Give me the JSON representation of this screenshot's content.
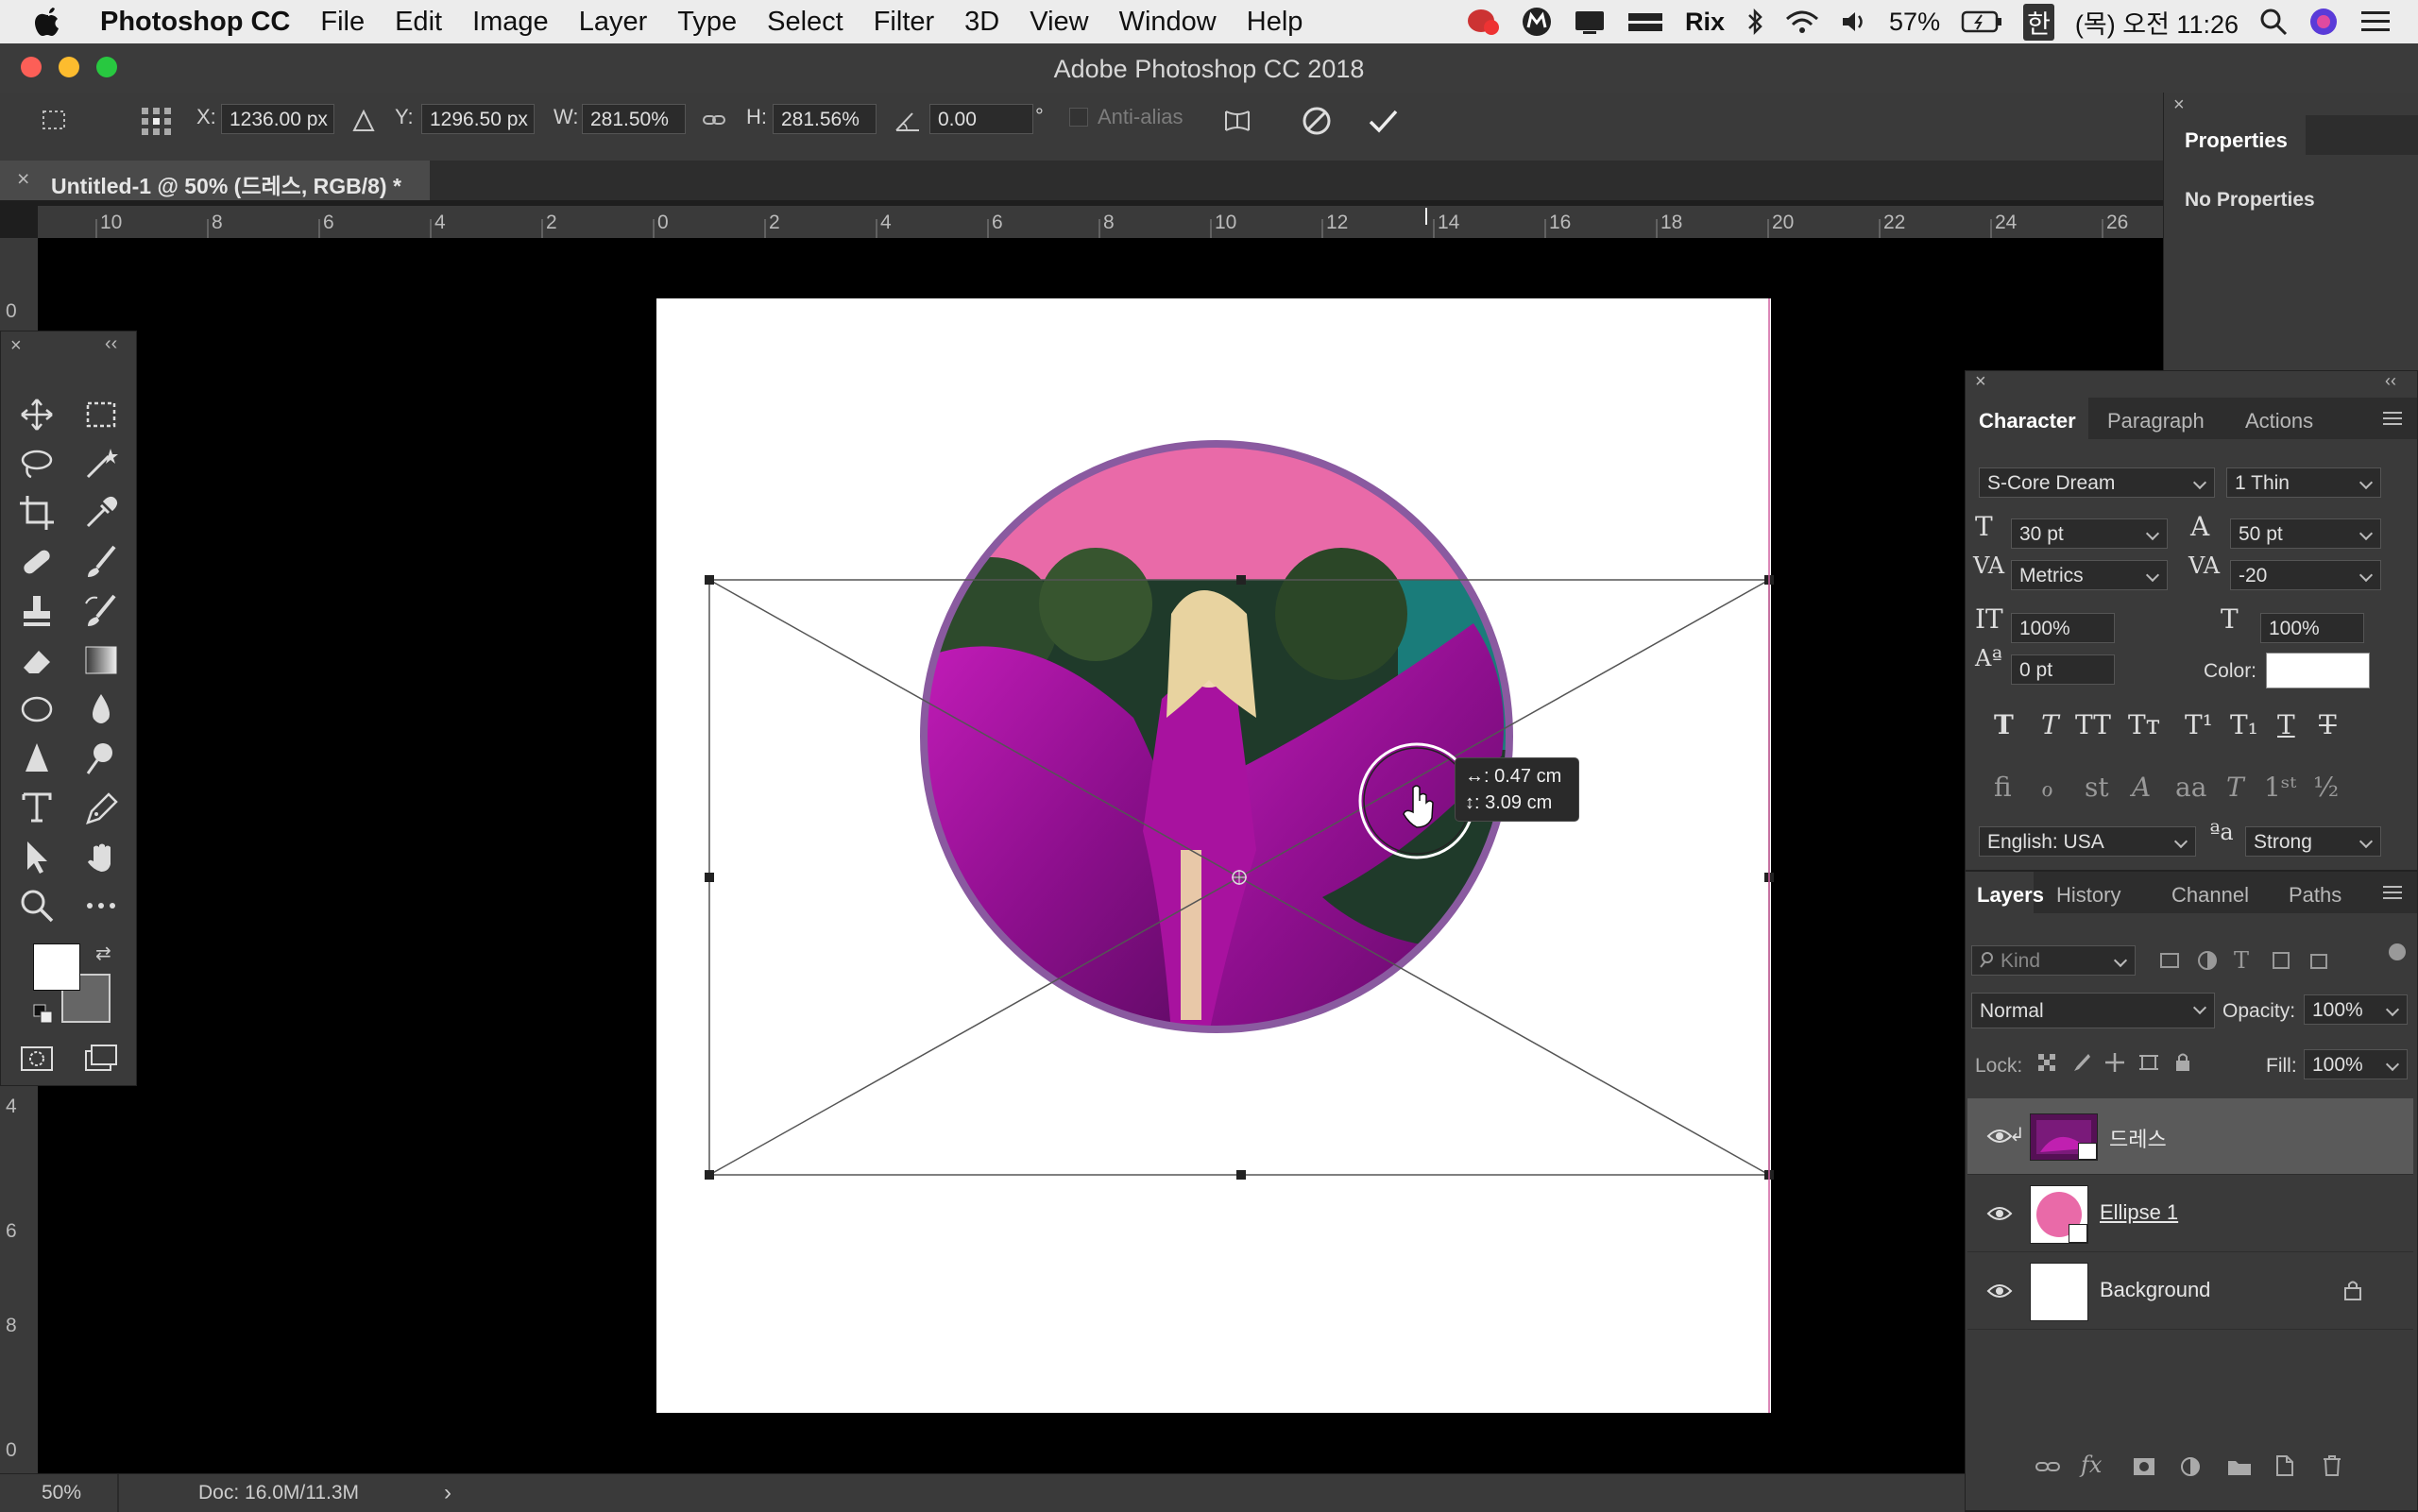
{
  "menubar": {
    "app_name": "Photoshop CC",
    "items": [
      "File",
      "Edit",
      "Image",
      "Layer",
      "Type",
      "Select",
      "Filter",
      "3D",
      "View",
      "Window",
      "Help"
    ],
    "rix": "Rix",
    "battery": "57%",
    "ime": "한",
    "clock": "(목) 오전 11:26"
  },
  "window": {
    "title": "Adobe Photoshop CC 2018"
  },
  "options": {
    "x_label": "X:",
    "x_value": "1236.00 px",
    "y_label": "Y:",
    "y_value": "1296.50 px",
    "w_label": "W:",
    "w_value": "281.50%",
    "h_label": "H:",
    "h_value": "281.56%",
    "angle_value": "0.00",
    "degree": "°",
    "antialias": "Anti-alias"
  },
  "document": {
    "tab_label": "Untitled-1 @ 50% (드레스, RGB/8) *",
    "ruler_h": [
      "10",
      "8",
      "6",
      "4",
      "2",
      "0",
      "2",
      "4",
      "6",
      "8",
      "10",
      "12",
      "14",
      "16",
      "18",
      "20",
      "22",
      "24",
      "26"
    ],
    "ruler_v": [
      "0",
      "4",
      "6",
      "8",
      "0"
    ]
  },
  "tooltip": {
    "line1": "↔: 0.47 cm",
    "line2": "↕: 3.09 cm"
  },
  "statusbar": {
    "zoom": "50%",
    "doc": "Doc: 16.0M/11.3M"
  },
  "properties": {
    "tab": "Properties",
    "content": "No Properties"
  },
  "character": {
    "tabs": [
      "Character",
      "Paragraph",
      "Actions"
    ],
    "font_family": "S-Core Dream",
    "font_style": "1 Thin",
    "font_size": "30 pt",
    "leading": "50 pt",
    "kerning": "Metrics",
    "tracking": "-20",
    "vscale": "100%",
    "hscale": "100%",
    "baseline": "0 pt",
    "color_label": "Color:",
    "language": "English: USA",
    "antialias": "Strong"
  },
  "layers": {
    "tabs": [
      "Layers",
      "History",
      "Channel",
      "Paths"
    ],
    "filter_kind": "Kind",
    "blend_mode": "Normal",
    "opacity_label": "Opacity:",
    "opacity": "100%",
    "lock_label": "Lock:",
    "fill_label": "Fill:",
    "fill": "100%",
    "items": [
      {
        "name": "드레스",
        "selected": true
      },
      {
        "name": "Ellipse 1",
        "selected": false
      },
      {
        "name": "Background",
        "selected": false
      }
    ]
  },
  "colors": {
    "ellipse_fill": "#e96aa8",
    "ellipse_stroke": "#8a5aa0",
    "photo_magenta": "#a0129a",
    "panel_bg": "#3a3a3a"
  }
}
